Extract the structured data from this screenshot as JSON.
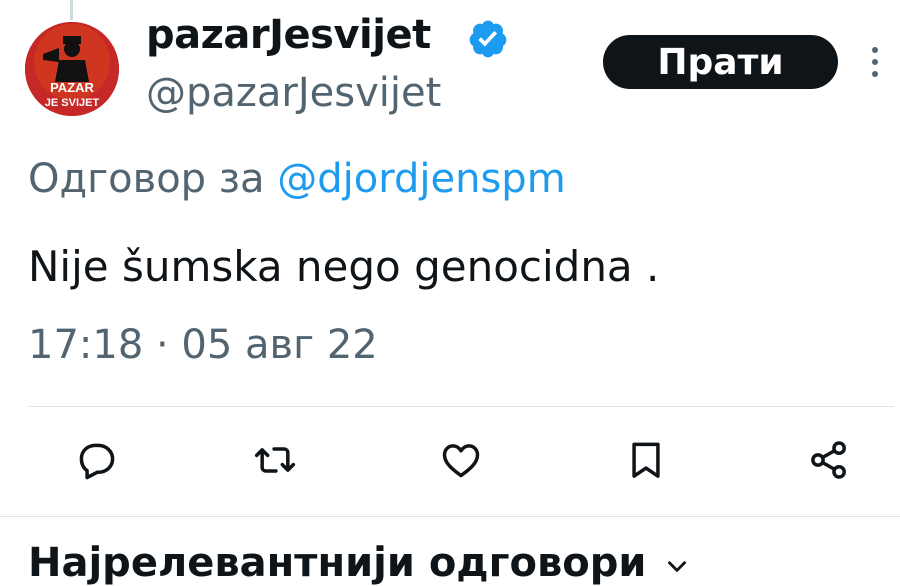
{
  "tweet": {
    "author": {
      "display_name": "pazarJesvijet",
      "handle": "@pazarJesvijet",
      "verified": true,
      "avatar_text_line1": "PAZAR",
      "avatar_text_line2": "JE SVIJET"
    },
    "follow_label": "Прати",
    "reply_prefix": "Одговор за ",
    "reply_to": "@djordjenspm",
    "text": "Nije šumska nego genocidna .",
    "timestamp": "17:18 · 05 авг 22"
  },
  "actions": [
    {
      "name": "reply",
      "icon": "reply-icon"
    },
    {
      "name": "retweet",
      "icon": "retweet-icon"
    },
    {
      "name": "like",
      "icon": "heart-icon"
    },
    {
      "name": "bookmark",
      "icon": "bookmark-icon"
    },
    {
      "name": "share",
      "icon": "share-icon"
    }
  ],
  "replies_sort": {
    "label": "Најрелевантнији одговори"
  },
  "colors": {
    "link": "#1d9bf0",
    "secondary_text": "#536471",
    "primary_text": "#0f1419",
    "follow_bg": "#0f1419"
  }
}
